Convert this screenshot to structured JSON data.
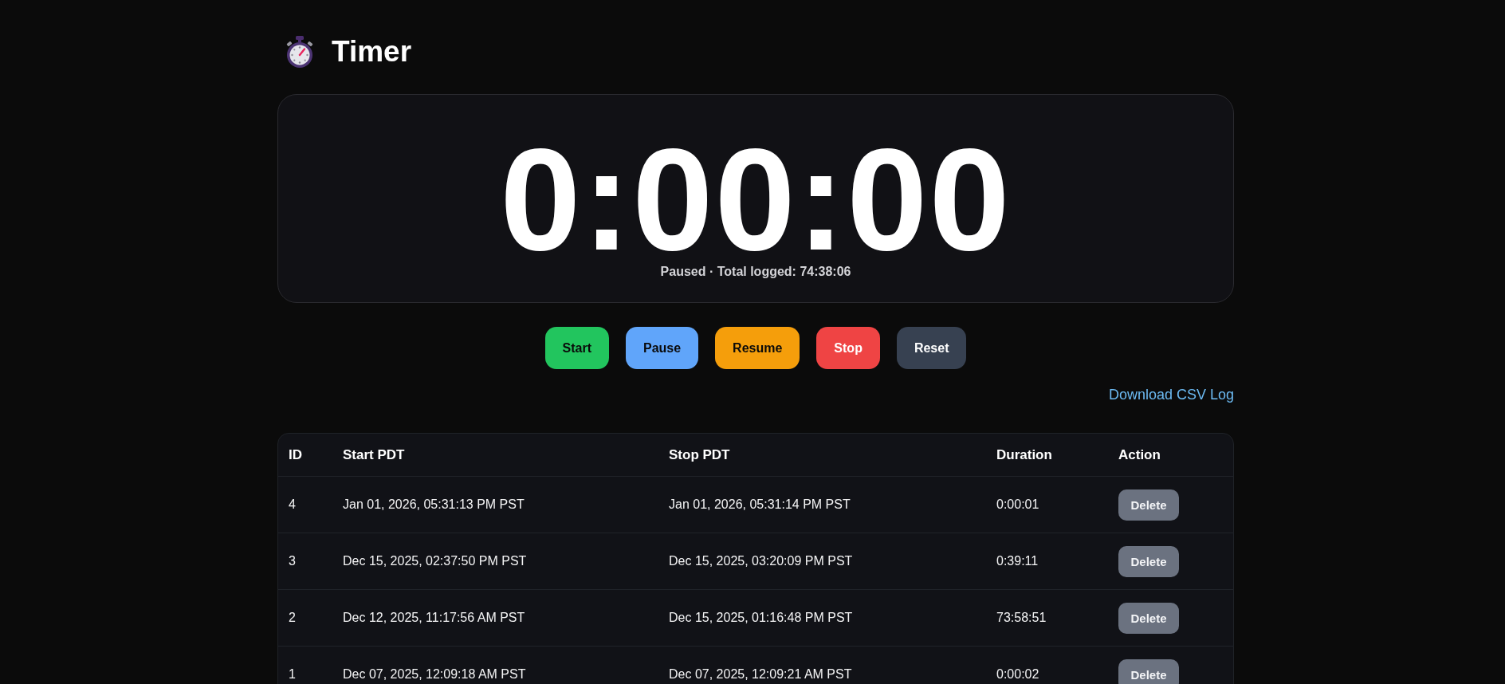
{
  "header": {
    "title": "Timer"
  },
  "timer": {
    "display": "0:00:00",
    "status": "Paused · Total logged: 74:38:06"
  },
  "controls": [
    {
      "label": "Start",
      "kind": "start"
    },
    {
      "label": "Pause",
      "kind": "pause"
    },
    {
      "label": "Resume",
      "kind": "resume"
    },
    {
      "label": "Stop",
      "kind": "stop"
    },
    {
      "label": "Reset",
      "kind": "reset"
    }
  ],
  "download_link": {
    "label": "Download CSV Log"
  },
  "table": {
    "columns": [
      "ID",
      "Start PDT",
      "Stop PDT",
      "Duration",
      "Action"
    ],
    "rows": [
      {
        "id": "4",
        "start": "Jan 01, 2026, 05:31:13 PM PST",
        "stop": "Jan 01, 2026, 05:31:14 PM PST",
        "duration": "0:00:01",
        "action": "Delete"
      },
      {
        "id": "3",
        "start": "Dec 15, 2025, 02:37:50 PM PST",
        "stop": "Dec 15, 2025, 03:20:09 PM PST",
        "duration": "0:39:11",
        "action": "Delete"
      },
      {
        "id": "2",
        "start": "Dec 12, 2025, 11:17:56 AM PST",
        "stop": "Dec 15, 2025, 01:16:48 PM PST",
        "duration": "73:58:51",
        "action": "Delete"
      },
      {
        "id": "1",
        "start": "Dec 07, 2025, 12:09:18 AM PST",
        "stop": "Dec 07, 2025, 12:09:21 AM PST",
        "duration": "0:00:02",
        "action": "Delete"
      }
    ]
  }
}
